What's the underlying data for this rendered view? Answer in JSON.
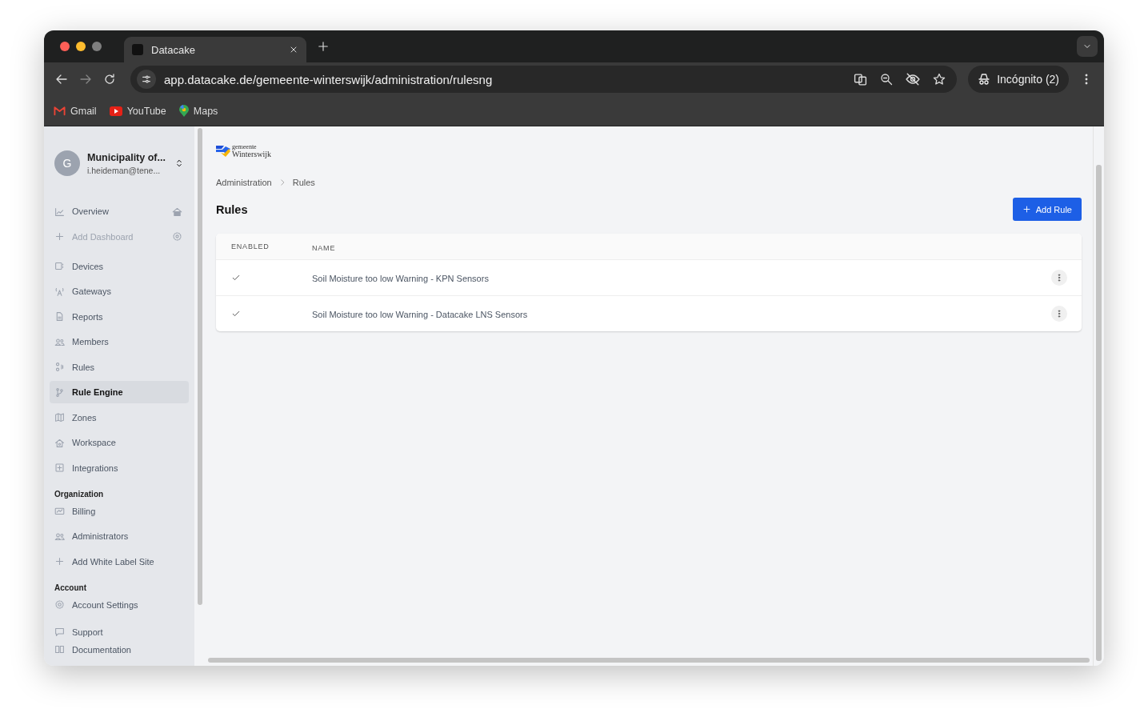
{
  "browser": {
    "tabs": [
      {
        "title": "Datacake",
        "selected": true
      }
    ],
    "url": "app.datacake.de/gemeente-winterswijk/administration/rulesng",
    "bookmarks": [
      {
        "label": "Gmail"
      },
      {
        "label": "YouTube"
      },
      {
        "label": "Maps"
      }
    ],
    "profile": "Incógnito (2)"
  },
  "workspace": {
    "avatar": "G",
    "name": "Municipality of...",
    "email": "i.heideman@tene..."
  },
  "sidebar": {
    "groups": [
      {
        "items": [
          {
            "label": "Overview",
            "selected": false,
            "disabled": false
          },
          {
            "label": "Add Dashboard",
            "selected": false,
            "disabled": true
          }
        ]
      },
      {
        "items": [
          {
            "label": "Devices",
            "selected": false,
            "disabled": false
          },
          {
            "label": "Gateways",
            "selected": false,
            "disabled": false
          },
          {
            "label": "Reports",
            "selected": false,
            "disabled": false
          },
          {
            "label": "Members",
            "selected": false,
            "disabled": false
          },
          {
            "label": "Rules",
            "selected": false,
            "disabled": false
          },
          {
            "label": "Rule Engine",
            "selected": true,
            "disabled": false
          },
          {
            "label": "Zones",
            "selected": false,
            "disabled": false
          },
          {
            "label": "Workspace",
            "selected": false,
            "disabled": false
          },
          {
            "label": "Integrations",
            "selected": false,
            "disabled": false
          }
        ]
      },
      {
        "heading": "Organization",
        "items": [
          {
            "label": "Billing",
            "selected": false,
            "disabled": false
          },
          {
            "label": "Administrators",
            "selected": false,
            "disabled": false
          },
          {
            "label": "Add White Label Site",
            "selected": false,
            "disabled": false
          }
        ]
      },
      {
        "heading": "Account",
        "items": [
          {
            "label": "Account Settings",
            "selected": false,
            "disabled": false
          }
        ]
      },
      {
        "items": [
          {
            "label": "Support",
            "selected": false,
            "disabled": false
          },
          {
            "label": "Documentation",
            "selected": false,
            "disabled": false
          }
        ]
      }
    ]
  },
  "logo": {
    "line1": "gemeente",
    "line2": "Winterswijk"
  },
  "breadcrumb": [
    "Administration",
    "Rules"
  ],
  "title": "Rules",
  "add_button": "Add Rule",
  "table": {
    "columns": [
      "ENABLED",
      "NAME"
    ],
    "rows": [
      {
        "enabled": true,
        "name": "Soil Moisture too low Warning - KPN Sensors"
      },
      {
        "enabled": true,
        "name": "Soil Moisture too low Warning - Datacake LNS Sensors"
      }
    ]
  }
}
